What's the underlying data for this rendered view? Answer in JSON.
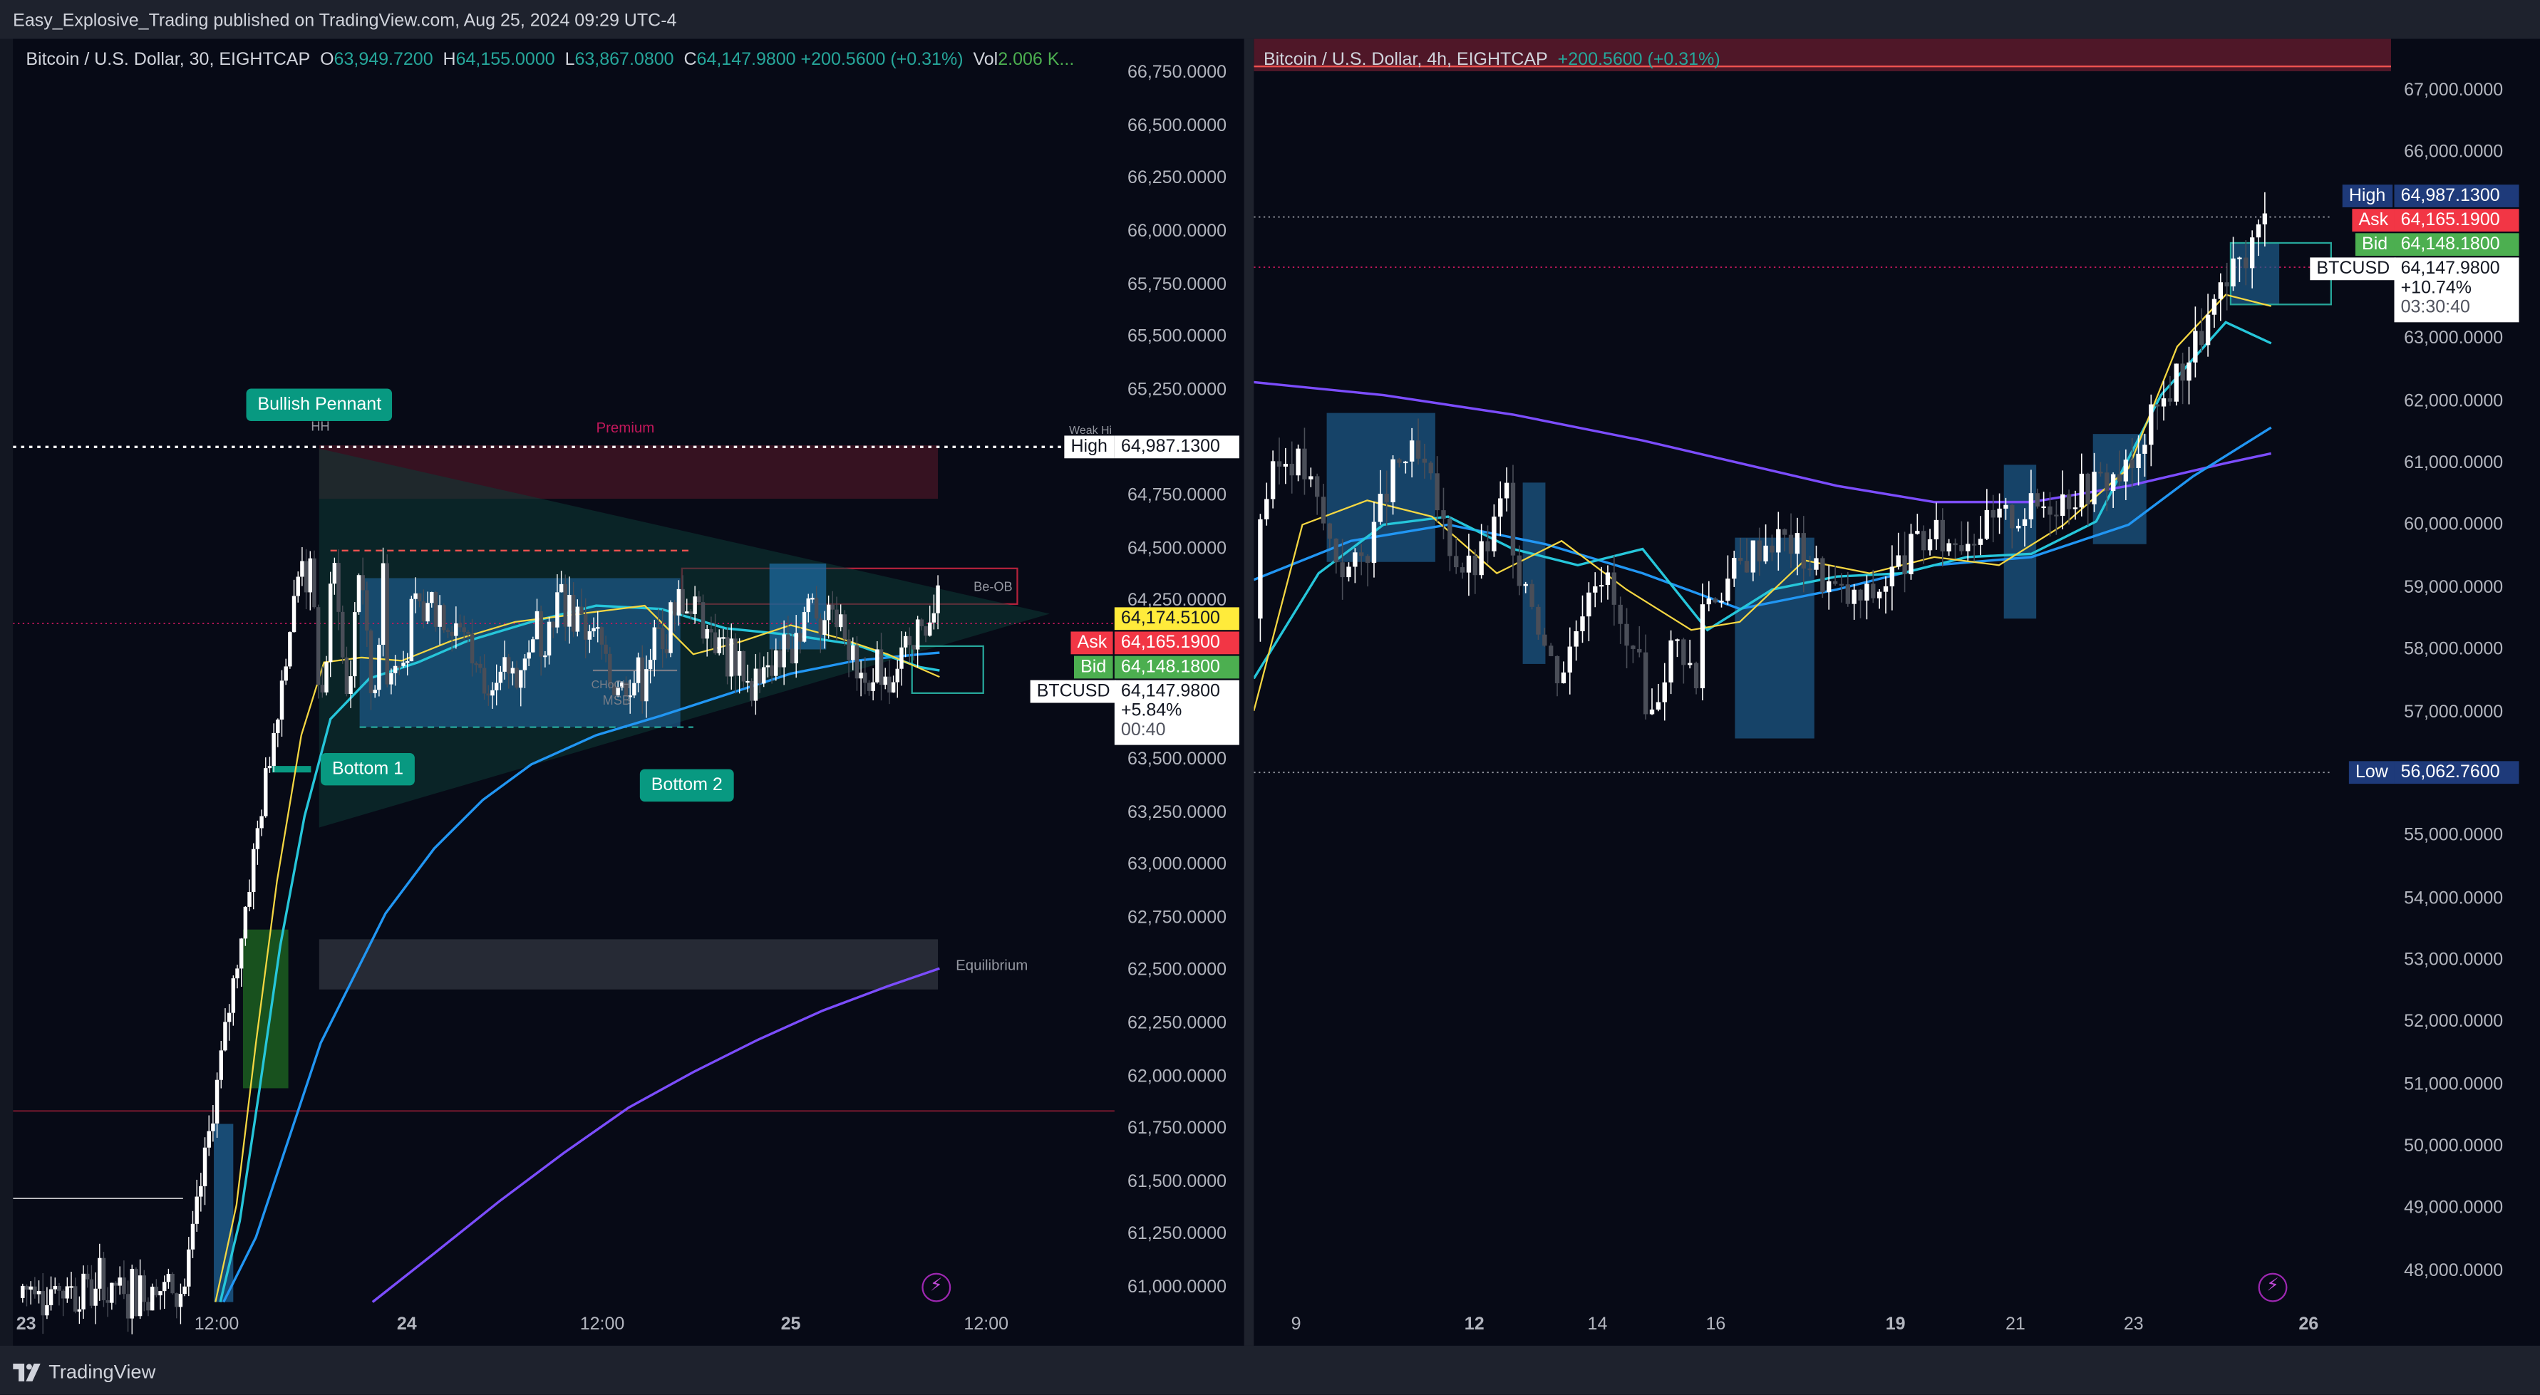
{
  "header": {
    "publisher_text": "Easy_Explosive_Trading published on TradingView.com, Aug 25, 2024 09:29 UTC-4"
  },
  "footer": {
    "brand": "TradingView"
  },
  "left_chart": {
    "legend": {
      "symbol": "Bitcoin / U.S. Dollar, 30, EIGHTCAP",
      "o_label": "O",
      "o_value": "63,949.7200",
      "h_label": "H",
      "h_value": "64,155.0000",
      "l_label": "L",
      "l_value": "63,867.0800",
      "c_label": "C",
      "c_value": "64,147.9800",
      "change": "+200.5600 (+0.31%)",
      "vol_label": "Vol",
      "vol_value": "2.006 K..."
    },
    "price_axis": [
      "66,750.0000",
      "66,500.0000",
      "66,250.0000",
      "66,000.0000",
      "65,750.0000",
      "65,500.0000",
      "65,250.0000",
      "64,750.0000",
      "64,500.0000",
      "64,250.0000",
      "63,500.0000",
      "63,250.0000",
      "63,000.0000",
      "62,750.0000",
      "62,500.0000",
      "62,250.0000",
      "62,000.0000",
      "61,750.0000",
      "61,500.0000",
      "61,250.0000",
      "61,000.0000"
    ],
    "time_axis": [
      "23",
      "12:00",
      "24",
      "12:00",
      "25",
      "12:00"
    ],
    "tags": {
      "high_label": "High",
      "high_value": "64,987.1300",
      "last_value": "64,174.5100",
      "ask_label": "Ask",
      "ask_value": "64,165.1900",
      "bid_label": "Bid",
      "bid_value": "64,148.1800",
      "symbol_label": "BTCUSD",
      "close_value": "64,147.9800",
      "close_change": "+5.84%",
      "countdown": "00:40"
    },
    "annotations": {
      "bullish_pennant": "Bullish Pennant",
      "hh": "HH",
      "weak_high": "Weak Hi",
      "premium": "Premium",
      "be_ob": "Be-OB",
      "bottom1": "Bottom 1",
      "bottom2": "Bottom 2",
      "choch": "CHoCH",
      "msb": "MSB",
      "equilibrium": "Equilibrium"
    }
  },
  "right_chart": {
    "legend": {
      "symbol": "Bitcoin / U.S. Dollar, 4h, EIGHTCAP",
      "change": "+200.5600 (+0.31%)"
    },
    "price_axis": [
      "67,000.0000",
      "66,000.0000",
      "63,000.0000",
      "62,000.0000",
      "61,000.0000",
      "60,000.0000",
      "59,000.0000",
      "58,000.0000",
      "57,000.0000",
      "55,000.0000",
      "54,000.0000",
      "53,000.0000",
      "52,000.0000",
      "51,000.0000",
      "50,000.0000",
      "49,000.0000",
      "48,000.0000"
    ],
    "time_axis": [
      "9",
      "12",
      "14",
      "16",
      "19",
      "21",
      "23",
      "26"
    ],
    "tags": {
      "high_label": "High",
      "high_value": "64,987.1300",
      "ask_label": "Ask",
      "ask_value": "64,165.1900",
      "bid_label": "Bid",
      "bid_value": "64,148.1800",
      "symbol_label": "BTCUSD",
      "close_value": "64,147.9800",
      "close_change": "+10.74%",
      "countdown": "03:30:40",
      "low_label": "Low",
      "low_value": "56,062.7600"
    }
  },
  "colors": {
    "background": "#070a16",
    "bull": "#ffffff",
    "bear": "#4a4e58",
    "accent_green": "#089981",
    "ema_fast": "#f5d742",
    "ema_mid": "#26c6da",
    "ema_slow": "#2196f3",
    "ema_long": "#7c4dff",
    "ask": "#f23645",
    "bid": "#4caf50",
    "high_tag": "#1e3a7a"
  }
}
